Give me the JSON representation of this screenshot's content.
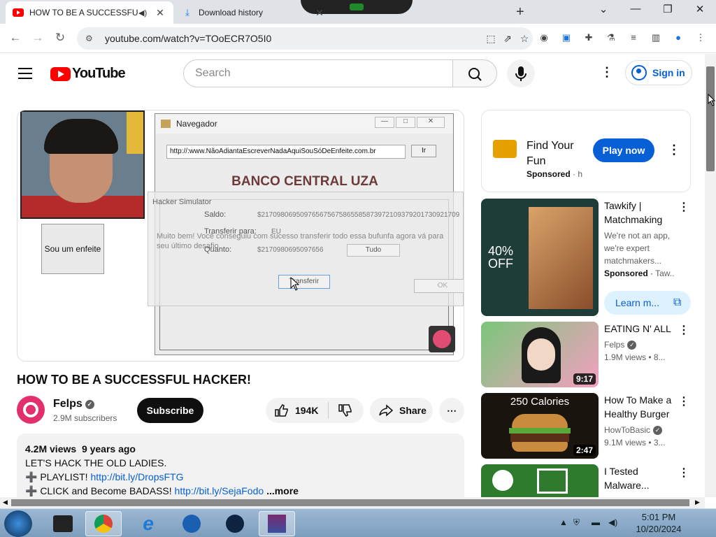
{
  "browser": {
    "tabs": [
      {
        "title": "HOW TO BE A SUCCESSFUL",
        "active": true
      },
      {
        "title": "Download history",
        "active": false
      }
    ],
    "url": "youtube.com/watch?v=TOoECR7O5I0"
  },
  "masthead": {
    "logo_text": "YouTube",
    "search_placeholder": "Search",
    "sign_in": "Sign in"
  },
  "player": {
    "webcam_button": "Sou um enfeite",
    "window_title": "Navegador",
    "address": "http://:www.NãoAdiantaEscreverNadaAquiSouSóDeEnfeite.com.br",
    "go_button": "Ir",
    "bank_title": "BANCO CENTRAL UZA",
    "ghost_title": "Hacker Simulator",
    "saldo_label": "Saldo:",
    "saldo_value": "$2170980695097656756758655858739721093792017309217092",
    "transferir_label": "Transferir para:",
    "transferir_value": "EU",
    "quanto_label": "Quanto:",
    "quanto_value": "$2170980695097656",
    "tudo_button": "Tudo",
    "message": "Muito bem! Você conseguiu com sucesso transferir todo essa bufunfa agora vá para seu último desafio.",
    "transfer_button": "Transferir",
    "ok_button": "OK"
  },
  "video": {
    "title": "HOW TO BE A SUCCESSFUL HACKER!",
    "channel": "Felps",
    "subscribers": "2.9M subscribers",
    "subscribe_label": "Subscribe",
    "likes": "194K",
    "share_label": "Share",
    "views": "4.2M views",
    "age": "9 years ago",
    "desc_line1": "LET'S HACK THE OLD LADIES.",
    "desc_line2_prefix": "➕ PLAYLIST! ",
    "desc_line2_link": "http://bit.ly/DropsFTG",
    "desc_line3_prefix": "➕ CLICK and Become BADASS! ",
    "desc_line3_link": "http://bit.ly/SejaFodo",
    "more_label": "...more"
  },
  "sidebar": {
    "ad": {
      "title": "Find Your Fun",
      "sponsored": "Sponsored",
      "domain": "h",
      "button": "Play now"
    },
    "items": [
      {
        "title": "Tawkify | Matchmaking",
        "line2": "We're not an app,",
        "line3": "we're expert",
        "line4": "matchmakers...",
        "sponsor": "Sponsored",
        "sponsor_domain": "Taw...",
        "thumb_text": "40% OFF",
        "button": "Learn m..."
      },
      {
        "title": "EATING N' ALL",
        "channel": "Felps",
        "stats": "1.9M views • 8...",
        "duration": "9:17"
      },
      {
        "title": "How To Make a Healthy Burger",
        "channel": "HowToBasic",
        "stats": "9.1M views • 3...",
        "duration": "2:47",
        "thumb_text": "250 Calories"
      },
      {
        "title": "I Tested Malware...",
        "channel": "",
        "stats": ""
      }
    ]
  },
  "taskbar": {
    "time": "5:01 PM",
    "date": "10/20/2024"
  },
  "colors": {
    "youtube_red": "#ff0000",
    "link_blue": "#065fd4",
    "taskbar": "#8aa9c8"
  }
}
